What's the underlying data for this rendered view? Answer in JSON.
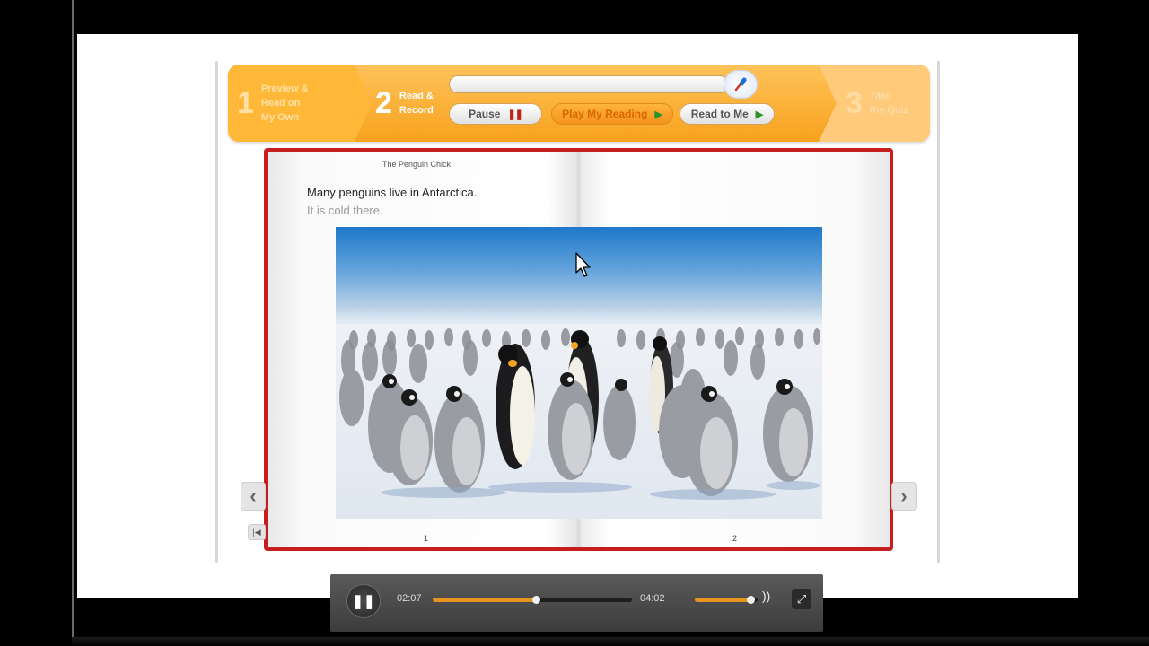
{
  "steps": [
    {
      "number": "1",
      "label_line1": "Preview &",
      "label_line2": "Read on",
      "label_line3": "My Own"
    },
    {
      "number": "2",
      "label_line1": "Read &",
      "label_line2": "Record"
    },
    {
      "number": "3",
      "label_line1": "Take",
      "label_line2": "the Quiz"
    }
  ],
  "controls": {
    "pause_label": "Pause",
    "play_reading_label": "Play My Reading",
    "read_to_me_label": "Read to Me",
    "mic_icon": "microphone-icon"
  },
  "book": {
    "title": "The Penguin Chick",
    "line1": "Many penguins live in Antarctica.",
    "line2": "It is cold there.",
    "left_page_number": "1",
    "right_page_number": "2",
    "photo_subject": "penguins-photo"
  },
  "player": {
    "elapsed": "02:07",
    "duration": "04:02",
    "progress": 0.52,
    "volume": 0.88
  },
  "colors": {
    "step_bar": "#f7a21d",
    "book_border": "#c41e1e",
    "progress_fill": "#e6921e"
  }
}
